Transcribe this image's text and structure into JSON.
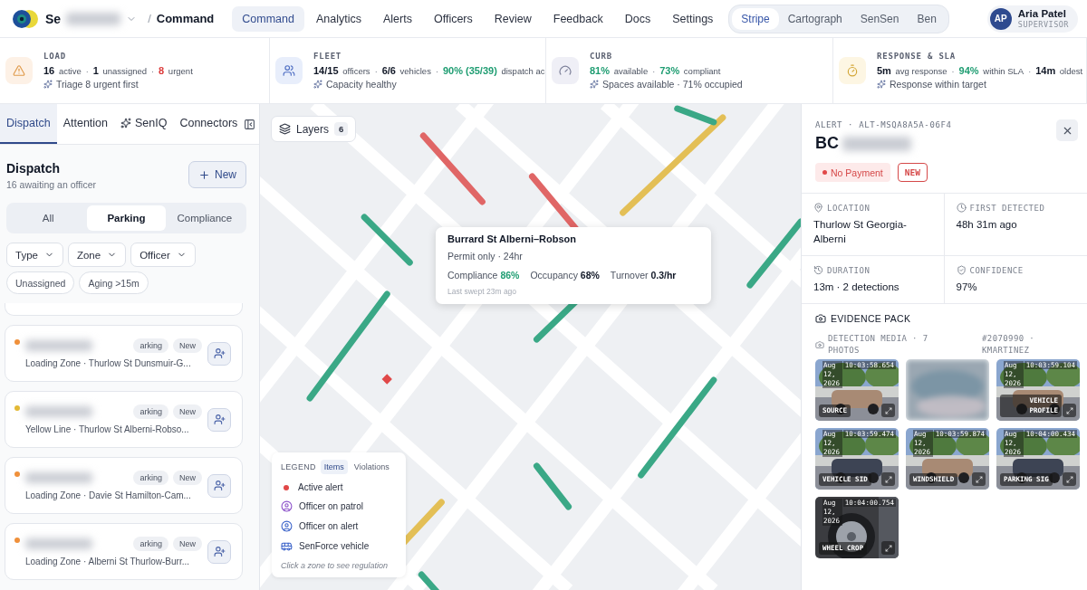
{
  "header": {
    "brand": "Se",
    "separator": "/",
    "page": "Command"
  },
  "nav": [
    {
      "label": "Command",
      "selected": true
    },
    {
      "label": "Analytics",
      "selected": false
    },
    {
      "label": "Alerts",
      "selected": false
    },
    {
      "label": "Officers",
      "selected": false
    },
    {
      "label": "Review",
      "selected": false
    },
    {
      "label": "Feedback",
      "selected": false
    },
    {
      "label": "Docs",
      "selected": false
    },
    {
      "label": "Settings",
      "selected": false
    }
  ],
  "workspaces": [
    {
      "label": "Stripe",
      "selected": true
    },
    {
      "label": "Cartograph",
      "selected": false
    },
    {
      "label": "SenSen",
      "selected": false
    },
    {
      "label": "Ben",
      "selected": false
    }
  ],
  "user": {
    "initials": "AP",
    "name": "Aria Patel",
    "role": "SUPERVISOR"
  },
  "stats": [
    {
      "kind": "warning",
      "title": "LOAD",
      "parts": [
        {
          "text": "**16** active",
          "color": "#111827"
        },
        {
          "sep": "·",
          "text": "**1** unassigned",
          "color": "#111827"
        },
        {
          "sep": "·",
          "text": "**8** urgent",
          "color": "#dc3b3b"
        }
      ],
      "note": "Triage 8 urgent first"
    },
    {
      "kind": "people",
      "title": "FLEET",
      "parts": [
        {
          "text": "**14/15** officers",
          "color": "#111827"
        },
        {
          "sep": "·",
          "text": "**6/6** vehicles",
          "color": "#111827"
        },
        {
          "sep": "·",
          "text": "**90% (35/39)** dispatch ac",
          "color": "#1f9d72"
        }
      ],
      "note": "Capacity healthy"
    },
    {
      "kind": "gauge",
      "title": "CURB",
      "parts": [
        {
          "text": "**81%** available",
          "color": "#1f9d72"
        },
        {
          "sep": "·",
          "text": "**73%** compliant",
          "color": "#1f9d72"
        }
      ],
      "note": "Spaces available · 71% occupied"
    },
    {
      "kind": "timer",
      "title": "RESPONSE & SLA",
      "parts": [
        {
          "text": "**5m** avg response",
          "color": "#111827"
        },
        {
          "sep": "·",
          "text": "**94%** within SLA",
          "color": "#1f9d72"
        },
        {
          "sep": "·",
          "text": "**14m** oldest",
          "color": "#111827"
        }
      ],
      "note": "Response within target"
    }
  ],
  "sidebar": {
    "tabs": [
      {
        "label": "Dispatch",
        "kind": "plain",
        "selected": true
      },
      {
        "label": "Attention",
        "kind": "plain",
        "selected": false
      },
      {
        "label": "SenIQ",
        "kind": "ai",
        "selected": false
      },
      {
        "label": "Connectors",
        "kind": "plain",
        "selected": false
      }
    ],
    "title": "Dispatch",
    "subtitle": "16 awaiting an officer",
    "new_button": "New",
    "segments": [
      {
        "label": "All",
        "selected": false
      },
      {
        "label": "Parking",
        "selected": true
      },
      {
        "label": "Compliance",
        "selected": false
      }
    ],
    "filters": [
      "Type",
      "Zone",
      "Officer"
    ],
    "chips": [
      "Unassigned",
      "Aging >15m"
    ],
    "cards": [
      {
        "color": "#f0903a",
        "tags": [
          "arking",
          "New"
        ],
        "description": "Loading Zone · Thurlow St Dunsmuir-G..."
      },
      {
        "color": "#e3b935",
        "tags": [
          "arking",
          "New"
        ],
        "description": "Yellow Line · Thurlow St Alberni-Robso..."
      },
      {
        "color": "#f0903a",
        "tags": [
          "arking",
          "New"
        ],
        "description": "Loading Zone · Davie St Hamilton-Cam..."
      },
      {
        "color": "#f0903a",
        "tags": [
          "arking",
          "New"
        ],
        "description": "Loading Zone · Alberni St Thurlow-Burr..."
      }
    ]
  },
  "map": {
    "kind": "picture",
    "layers": {
      "label": "Layers",
      "count": "6"
    },
    "tooltip": {
      "title": "Burrard St Alberni–Robson",
      "subtitle": "Permit only · 24hr",
      "metrics": [
        {
          "label": "Compliance",
          "value": "86%",
          "color": "#1f9d72"
        },
        {
          "label": "Occupancy",
          "value": "68%",
          "color": "#111827"
        },
        {
          "label": "Turnover",
          "value": "0.3/hr",
          "color": "#111827"
        }
      ],
      "footer": "Last swept 23m ago"
    },
    "legend": {
      "title": "LEGEND",
      "tabs": [
        {
          "label": "Items",
          "selected": true
        },
        {
          "label": "Violations",
          "selected": false
        }
      ],
      "items": [
        {
          "kind": "alert",
          "label": "Active alert"
        },
        {
          "kind": "patrol",
          "label": "Officer on patrol"
        },
        {
          "kind": "officer_alert",
          "label": "Officer on alert"
        },
        {
          "kind": "vehicle",
          "label": "SenForce vehicle"
        }
      ],
      "note": "Click a zone to see regulation"
    }
  },
  "alert": {
    "eyebrow": "ALERT · ALT-MSQA8A5A-06F4",
    "plate": "BC",
    "badges": [
      {
        "kind": "status",
        "label": "No Payment"
      },
      {
        "kind": "outline",
        "label": "NEW"
      }
    ],
    "details": [
      {
        "kind": "location",
        "label": "LOCATION",
        "value": "Thurlow St Georgia-Alberni"
      },
      {
        "kind": "clock",
        "label": "FIRST DETECTED",
        "value": "48h 31m ago"
      },
      {
        "kind": "history",
        "label": "DURATION",
        "value": "13m · 2 detections"
      },
      {
        "kind": "shield",
        "label": "CONFIDENCE",
        "value": "97%"
      }
    ],
    "evidence_title": "EVIDENCE PACK",
    "media_title": "DETECTION MEDIA · 7 PHOTOS",
    "media_ref": "#2070990 · KMARTINEZ",
    "photos": [
      {
        "blurred": false,
        "date": "Aug 12, 2026",
        "time": "10:03:58.654",
        "label": "SOURCE"
      },
      {
        "blurred": true
      },
      {
        "blurred": false,
        "date": "Aug 12, 2026",
        "time": "10:03:59.104",
        "label": "VEHICLE PROFILE"
      },
      {
        "blurred": false,
        "date": "Aug 12, 2026",
        "time": "10:03:59.474",
        "label": "VEHICLE SID"
      },
      {
        "blurred": false,
        "date": "Aug 12, 2026",
        "time": "10:03:59.874",
        "label": "WINDSHIELD"
      },
      {
        "blurred": false,
        "date": "Aug 12, 2026",
        "time": "10:04:00.434",
        "label": "PARKING SIG"
      },
      {
        "blurred": false,
        "date": "Aug 12, 2026",
        "time": "10:04:00.754",
        "label": "WHEEL CROP"
      }
    ]
  }
}
